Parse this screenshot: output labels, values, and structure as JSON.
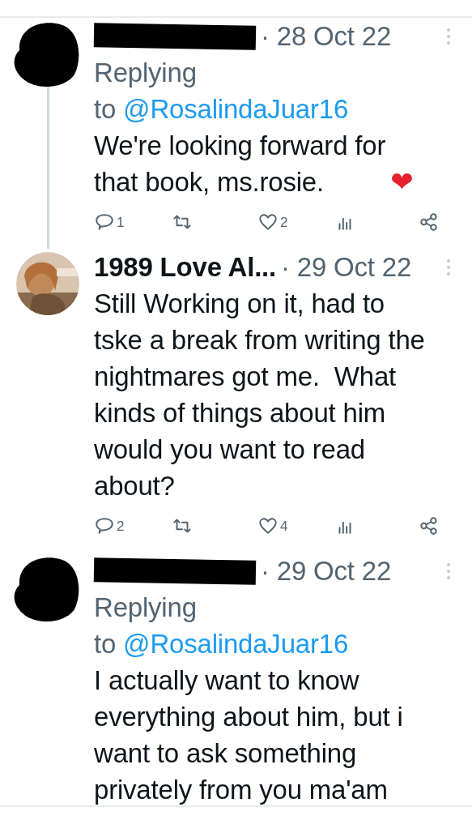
{
  "tweets": [
    {
      "author_hidden": true,
      "date": "· 28 Oct 22",
      "replying": "Replying",
      "replying_to_prefix": "to ",
      "replying_to": "@RosalindaJuar16",
      "text": "We're looking forward for\nthat book, ms.rosie.",
      "emoji": "❤",
      "replies": "1",
      "likes": "2",
      "thread_line": true
    },
    {
      "author_hidden": false,
      "author": "1989 Love Al...",
      "date": "· 29 Oct 22",
      "text": "Still Working on it, had to\ntske a break from writing the\nnightmares got me.  What\nkinds of things about him\nwould you want to read\nabout?",
      "replies": "2",
      "likes": "4",
      "thread_line": false
    },
    {
      "author_hidden": true,
      "date": "· 29 Oct 22",
      "replying": "Replying",
      "replying_to_prefix": "to ",
      "replying_to": "@RosalindaJuar16",
      "text": "I actually want to know\neverything about him, but i\nwant to ask something\nprivately from you ma'am",
      "thread_line": false
    }
  ]
}
